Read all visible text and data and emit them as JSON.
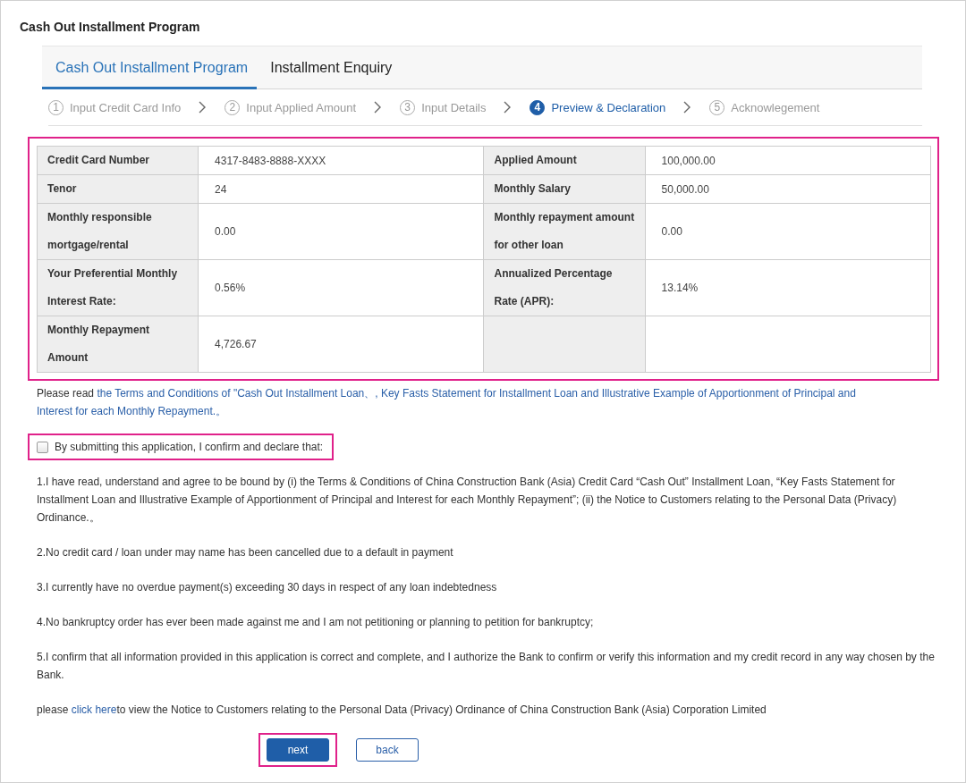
{
  "page_title": "Cash Out Installment Program",
  "tabs": [
    {
      "label": "Cash Out Installment Program",
      "selected": true
    },
    {
      "label": "Installment Enquiry",
      "selected": false
    }
  ],
  "steps": [
    {
      "number": "1",
      "label": "Input Credit Card Info",
      "selected": false
    },
    {
      "number": "2",
      "label": "Input Applied Amount",
      "selected": false
    },
    {
      "number": "3",
      "label": "Input Details",
      "selected": false
    },
    {
      "number": "4",
      "label": "Preview & Declaration",
      "selected": true
    },
    {
      "number": "5",
      "label": "Acknowlegement",
      "selected": false
    }
  ],
  "summary": {
    "highlighted": true,
    "rows": [
      [
        {
          "label": "Credit Card Number",
          "value": "4317-8483-8888-XXXX"
        },
        {
          "label": "Applied Amount",
          "value": "100,000.00"
        }
      ],
      [
        {
          "label": "Tenor",
          "value": "24"
        },
        {
          "label": "Monthly Salary",
          "value": "50,000.00"
        }
      ],
      [
        {
          "label": "Monthly responsible mortgage/rental",
          "value": "0.00"
        },
        {
          "label": "Monthly repayment amount for other loan",
          "value": "0.00"
        }
      ],
      [
        {
          "label": "Your Preferential Monthly Interest Rate:",
          "value": "0.56%"
        },
        {
          "label": "Annualized Percentage Rate (APR):",
          "value": "13.14%"
        }
      ],
      [
        {
          "label": "Monthly Repayment Amount",
          "value": "4,726.67"
        },
        {}
      ]
    ]
  },
  "terms_notice": {
    "text": "Please read",
    "links": [
      "the Terms and Conditions of \"Cash Out Installment Loan、, Key Fasts Statement for Installment Loan and Illustrative Example of Apportionment of Principal and",
      "Interest for each Monthly Repayment.。"
    ]
  },
  "declaration": {
    "label": "By submitting this application, I confirm and declare that:",
    "checked": false,
    "highlighted": true
  },
  "clauses": [
    "1.I have read, understand and agree to be bound by (i) the Terms & Conditions of China Construction Bank (Asia) Credit Card “Cash Out” Installment Loan, “Key Fasts Statement for Installment Loan and Illustrative Example of Apportionment of Principal and Interest for each Monthly Repayment”; (ii) the Notice to Customers relating to the Personal Data (Privacy) Ordinance.。",
    "2.No credit card / loan under may name has been cancelled due to a default in payment",
    "3.I currently have no overdue payment(s) exceeding 30 days in respect of any loan indebtedness",
    "4.No bankruptcy order has ever been made against me and I am not petitioning or planning to petition for bankruptcy;",
    "5.I confirm that all information provided in this application is correct and complete, and I authorize the Bank to confirm or verify this information and my credit record in any way chosen by the Bank."
  ],
  "privacy_notice": {
    "before": "please",
    "link": "click here",
    "after": "to view the Notice to Customers relating to the Personal Data (Privacy) Ordinance of China Construction Bank (Asia) Corporation Limited"
  },
  "buttons": [
    {
      "label": "next",
      "kind": "primary",
      "highlighted": true
    },
    {
      "label": "back",
      "kind": "secondary",
      "highlighted": false
    }
  ]
}
